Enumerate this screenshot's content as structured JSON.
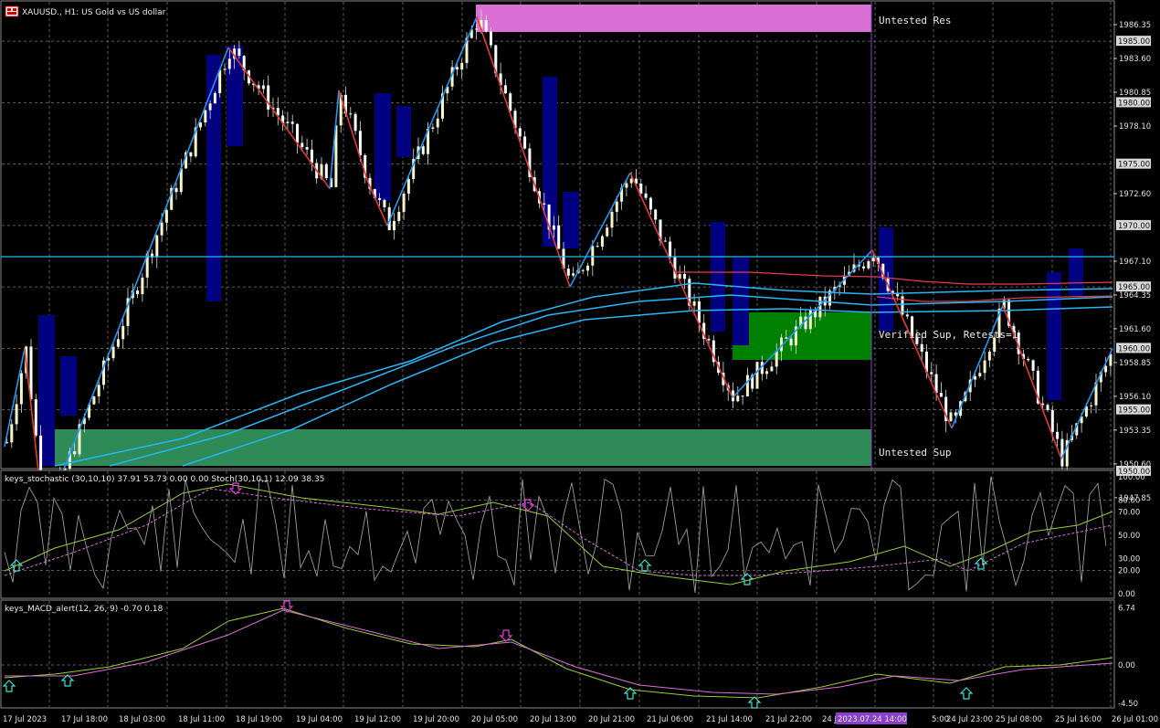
{
  "main_panel": {
    "title": "XAUUSD., H1:  US Gold vs US dollar",
    "price_ticks": [
      {
        "label": "1986.35",
        "boxed": false
      },
      {
        "label": "1985.00",
        "boxed": true
      },
      {
        "label": "1983.60",
        "boxed": false
      },
      {
        "label": "1980.85",
        "boxed": false
      },
      {
        "label": "1980.00",
        "boxed": true
      },
      {
        "label": "1978.10",
        "boxed": false
      },
      {
        "label": "1975.00",
        "boxed": true
      },
      {
        "label": "1972.60",
        "boxed": false
      },
      {
        "label": "1970.00",
        "boxed": true
      },
      {
        "label": "1967.10",
        "boxed": false
      },
      {
        "label": "1965.00",
        "boxed": true
      },
      {
        "label": "1964.35",
        "boxed": false
      },
      {
        "label": "1961.60",
        "boxed": false
      },
      {
        "label": "1960.00",
        "boxed": true
      },
      {
        "label": "1958.85",
        "boxed": false
      },
      {
        "label": "1956.10",
        "boxed": false
      },
      {
        "label": "1955.00",
        "boxed": true
      },
      {
        "label": "1953.35",
        "boxed": false
      },
      {
        "label": "1950.60",
        "boxed": false
      },
      {
        "label": "1950.00",
        "boxed": true
      },
      {
        "label": "1947.85",
        "boxed": false
      }
    ],
    "zones": [
      {
        "label": "Untested Res",
        "color": "#da70d6"
      },
      {
        "label": "Verified Sup, Retests=1",
        "color": "#008000"
      },
      {
        "label": "Untested Sup",
        "color": "#2e8b57"
      }
    ],
    "colors": {
      "bull": "#f5f5c8",
      "bear": "#ffffff",
      "zigzag_up": "#2196f3",
      "zigzag_down": "#e53935",
      "ma": "#29b6f6",
      "env": "#e53950",
      "box": "#000080"
    }
  },
  "stoch_panel": {
    "title": "keys_stochastic (30,10,10) 37.91 53.73 0.00 0.00 Stoch(30,10,1) 12.09 38.35",
    "ticks": [
      "100.00",
      "80.00",
      "70.00",
      "50.00",
      "30.00",
      "20.00",
      "0.00"
    ]
  },
  "macd_panel": {
    "title": "keys_MACD_alert(12, 26, 9) -0.70 0.18",
    "ticks": [
      "6.74",
      "0.00",
      "-4.50"
    ]
  },
  "time_axis": {
    "labels": [
      "17 Jul 2023",
      "17 Jul 18:00",
      "18 Jul 03:00",
      "18 Jul 11:00",
      "18 Jul 19:00",
      "19 Jul 04:00",
      "19 Jul 12:00",
      "19 Jul 20:00",
      "20 Jul 05:00",
      "20 Jul 13:00",
      "20 Jul 21:00",
      "21 Jul 06:00",
      "21 Jul 14:00",
      "21 Jul 22:00",
      "24 Jul",
      "5:00",
      "24 Jul 23:00",
      "25 Jul 08:00",
      "25 Jul 16:00",
      "26 Jul 01:00"
    ],
    "cursor_label": "2023.07.24 14:00"
  }
}
